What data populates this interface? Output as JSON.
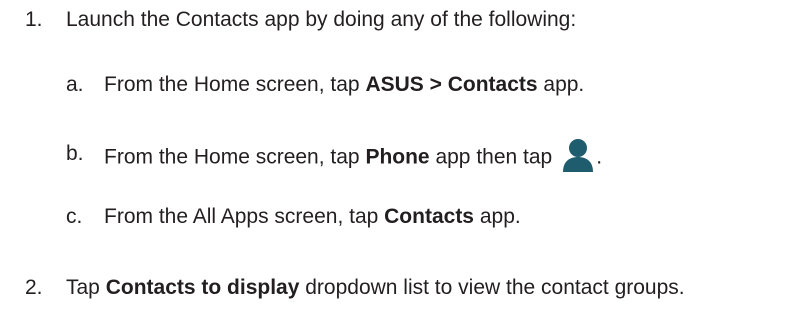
{
  "steps": [
    {
      "number": "1.",
      "text": "Launch the Contacts app by doing any of the following:",
      "substeps": [
        {
          "letter": "a.",
          "pre": "From the Home screen, tap ",
          "bold": "ASUS > Contacts",
          "post": " app."
        },
        {
          "letter": "b.",
          "pre": "From the Home screen, tap ",
          "bold": "Phone",
          "mid": " app then tap",
          "icon": "contact-person-icon",
          "post": "."
        },
        {
          "letter": "c.",
          "pre": "From the All Apps screen, tap ",
          "bold": "Contacts",
          "post": " app."
        }
      ]
    },
    {
      "number": "2.",
      "pre": "Tap ",
      "bold": "Contacts to display",
      "post": " dropdown list to view the contact groups."
    }
  ],
  "colors": {
    "text": "#231f20",
    "icon": "#1f5c6e"
  }
}
